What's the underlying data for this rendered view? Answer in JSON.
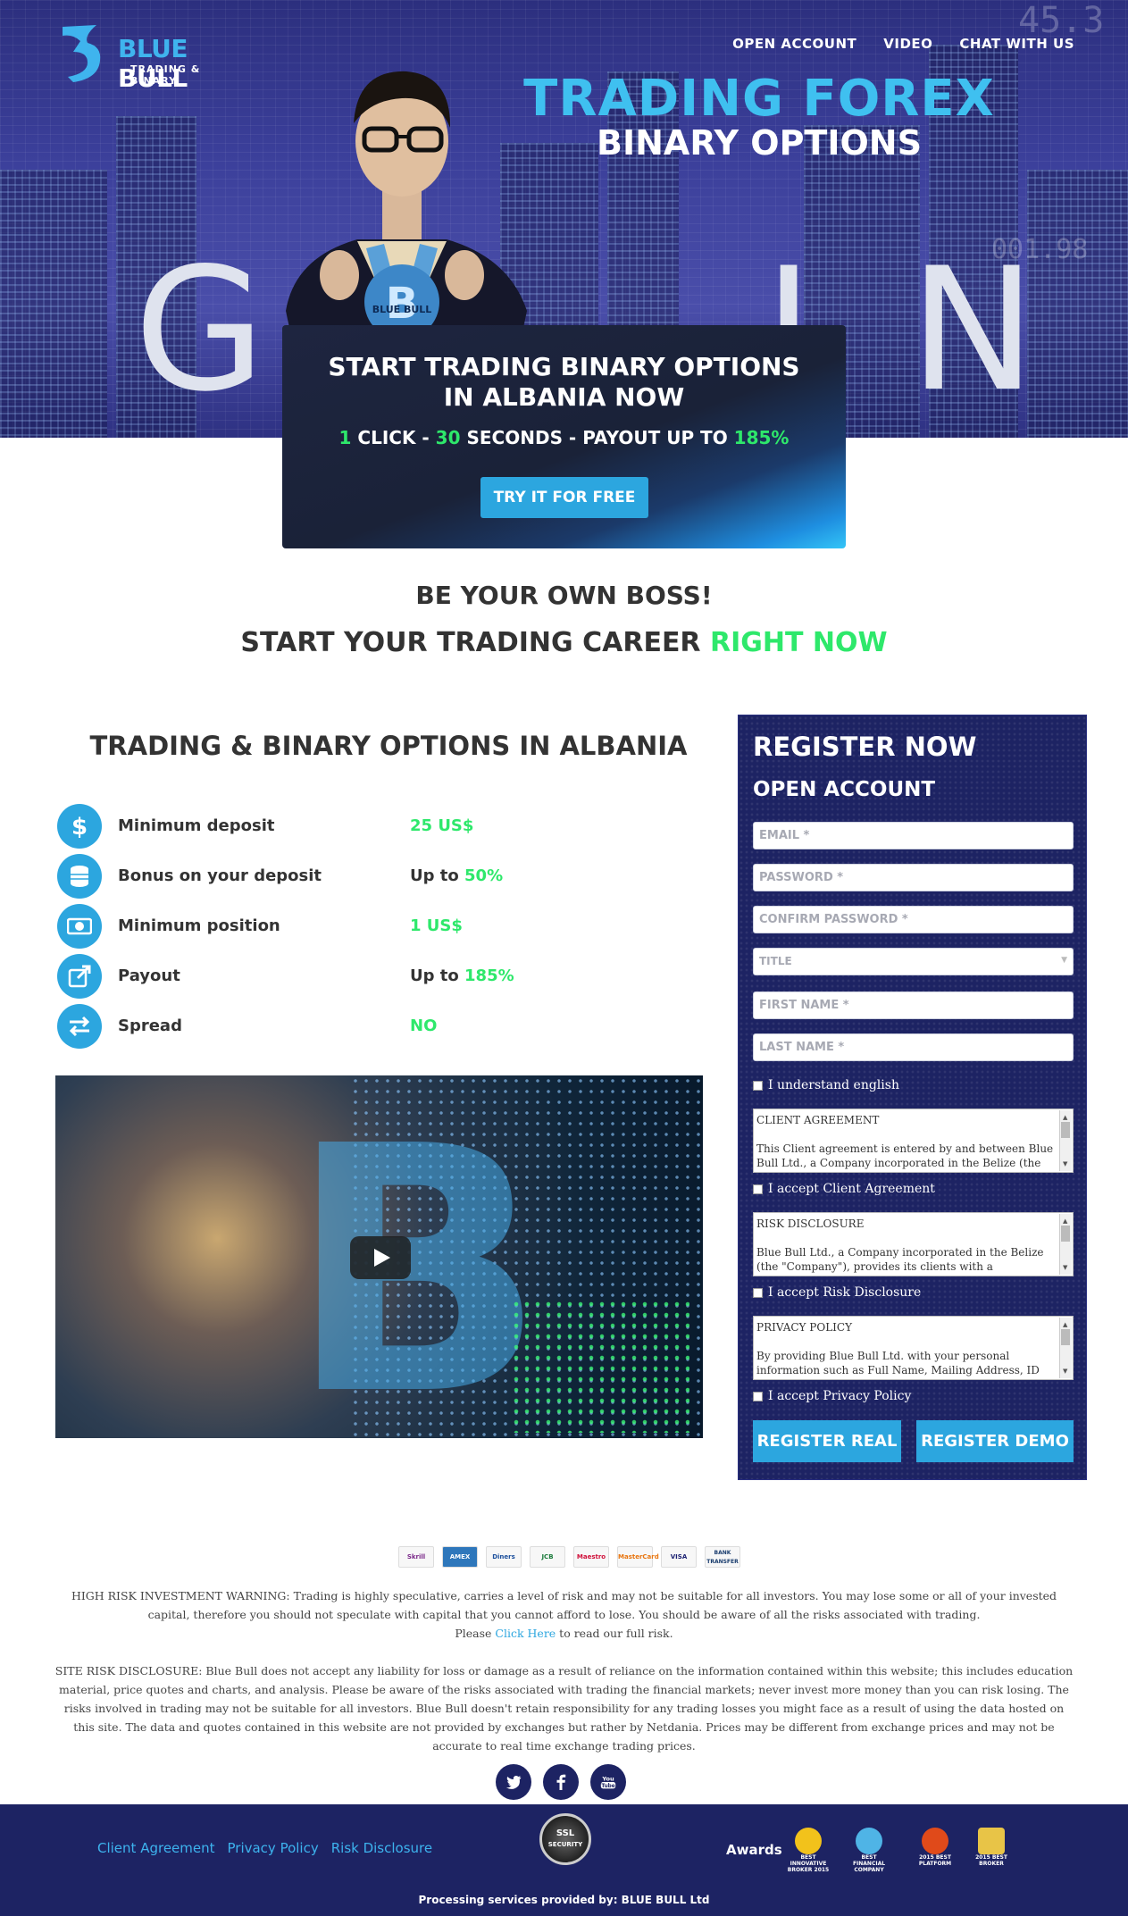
{
  "header": {
    "logo_name_part1": "BLUE",
    "logo_name_part2": " BULL",
    "logo_subtitle": "TRADING & BINARY",
    "nav": [
      {
        "label": "OPEN ACCOUNT"
      },
      {
        "label": "VIDEO"
      },
      {
        "label": "CHAT WITH US"
      }
    ]
  },
  "hero": {
    "title": "TRADING FOREX",
    "subtitle": "BINARY OPTIONS",
    "letters": [
      "G",
      "I",
      "N"
    ],
    "shirt_logo": "BLUE BULL"
  },
  "cta": {
    "title_line1": "START TRADING BINARY OPTIONS",
    "title_line2": "IN ALBANIA NOW",
    "n1": "1",
    "t1": " CLICK - ",
    "n2": "30",
    "t2": " SECONDS - PAYOUT UP TO ",
    "n3": "185%",
    "button": "TRY IT FOR FREE"
  },
  "tagline": {
    "line1": "BE YOUR OWN BOSS!",
    "line2_a": "START YOUR TRADING CAREER ",
    "line2_b": "RIGHT NOW"
  },
  "features": {
    "title": "TRADING & BINARY OPTIONS IN ALBANIA",
    "items": [
      {
        "icon": "dollar-icon",
        "label": "Minimum deposit",
        "prefix": "",
        "value": "25 US$"
      },
      {
        "icon": "coins-icon",
        "label": "Bonus on your deposit",
        "prefix": "Up to ",
        "value": "50%"
      },
      {
        "icon": "banknote-icon",
        "label": "Minimum position",
        "prefix": "",
        "value": "1 US$"
      },
      {
        "icon": "external-link-icon",
        "label": "Payout",
        "prefix": "Up to ",
        "value": "185%"
      },
      {
        "icon": "exchange-arrows-icon",
        "label": "Spread",
        "prefix": "",
        "value": "NO"
      }
    ]
  },
  "register": {
    "title": "REGISTER NOW",
    "subtitle": "OPEN ACCOUNT",
    "email_placeholder": "EMAIL *",
    "password_placeholder": "PASSWORD *",
    "confirm_placeholder": "CONFIRM PASSWORD *",
    "title_select": "TITLE",
    "first_name_placeholder": "FIRST NAME *",
    "last_name_placeholder": "LAST NAME *",
    "understand_english": "I understand english",
    "client_agreement_heading": "CLIENT AGREEMENT",
    "client_agreement_text": "This Client agreement is entered by and between Blue Bull Ltd., a Company incorporated in the Belize (the \"Company\")",
    "accept_client": "I accept Client Agreement",
    "risk_heading": "RISK DISCLOSURE",
    "risk_text": "Blue Bull Ltd., a Company incorporated in the Belize (the \"Company\"), provides its clients with a sophisticated",
    "accept_risk": "I accept Risk Disclosure",
    "privacy_heading": "PRIVACY POLICY",
    "privacy_text": "By providing Blue Bull Ltd. with your personal information such as Full Name, Mailing Address, ID number, Passport",
    "accept_privacy": "I accept Privacy Policy",
    "btn_real": "REGISTER REAL",
    "btn_demo": "REGISTER DEMO"
  },
  "payments": [
    "Skrill",
    "AMEX",
    "Diners",
    "JCB",
    "Maestro",
    "MasterCard",
    "VISA",
    "BANK TRANSFER"
  ],
  "disclaimer": {
    "warning": "HIGH RISK INVESTMENT WARNING: Trading is highly speculative, carries a level of risk and may not be suitable for all investors. You may lose some or all of your invested capital, therefore you should not speculate with capital that you cannot afford to lose. You should be aware of all the risks associated with trading.",
    "please": "Please ",
    "click_here": "Click Here",
    "read_full": " to read our full risk.",
    "site_risk": "SITE RISK DISCLOSURE: Blue Bull does not accept any liability for loss or damage as a result of reliance on the information contained within this website; this includes education material, price quotes and charts, and analysis. Please be aware of the risks associated with trading the financial markets; never invest more money than you can risk losing. The risks involved in trading may not be suitable for all investors. Blue Bull doesn't retain responsibility for any trading losses you might face as a result of using the data hosted on this site. The data and quotes contained in this website are not provided by exchanges but rather by Netdania. Prices may be different from exchange prices and may not be accurate to real time exchange trading prices."
  },
  "footer": {
    "links": [
      "Client Agreement",
      "Privacy Policy",
      "Risk Disclosure"
    ],
    "ssl_line1": "SSL",
    "ssl_line2": "SECURITY",
    "awards_label": "Awards",
    "awards": [
      "BEST INNOVATIVE BROKER 2015",
      "BEST FINANCIAL COMPANY",
      "2015 BEST PLATFORM",
      "2015 BEST BROKER"
    ],
    "processing": "Processing services provided by: BLUE BULL Ltd"
  },
  "colors": {
    "accent": "#2ca6df",
    "green": "#2ee86b",
    "navy": "#1d2363"
  }
}
